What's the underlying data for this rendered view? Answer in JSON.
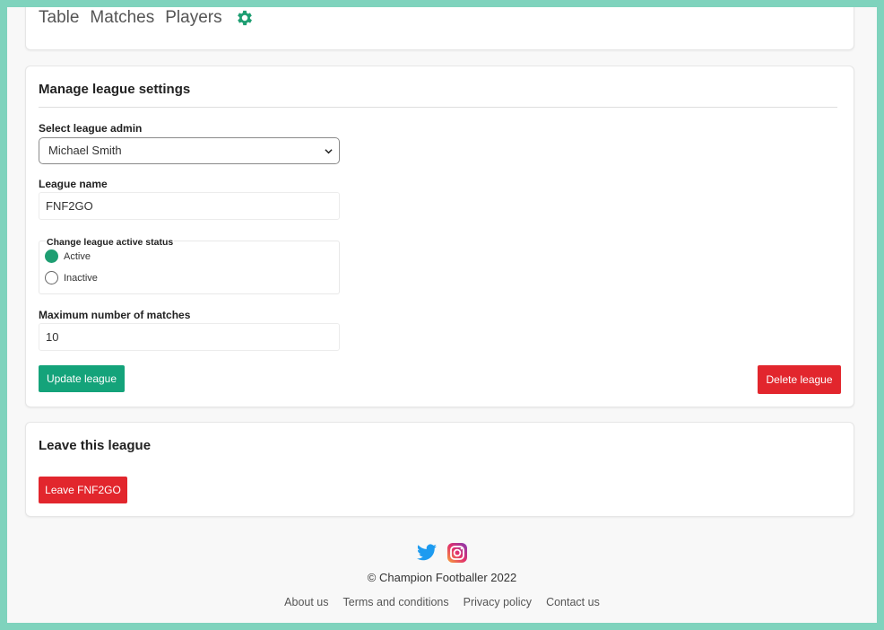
{
  "nav": {
    "tabs": [
      {
        "label": "Table"
      },
      {
        "label": "Matches"
      },
      {
        "label": "Players"
      }
    ],
    "settings_icon": "gear-icon",
    "accent": "#1e9e72"
  },
  "settings": {
    "title": "Manage league settings",
    "admin_label": "Select league admin",
    "admin_selected": "Michael Smith",
    "name_label": "League name",
    "name_value": "FNF2GO",
    "status_legend": "Change league active status",
    "status_options": [
      {
        "label": "Active",
        "checked": true
      },
      {
        "label": "Inactive",
        "checked": false
      }
    ],
    "max_matches_label": "Maximum number of matches",
    "max_matches_value": "10",
    "update_button": "Update league",
    "delete_button": "Delete league"
  },
  "leave": {
    "title": "Leave this league",
    "button": "Leave FNF2GO"
  },
  "footer": {
    "social": [
      {
        "icon": "twitter-icon"
      },
      {
        "icon": "instagram-icon"
      }
    ],
    "copyright": "© Champion Footballer 2022",
    "links": [
      {
        "label": "About us"
      },
      {
        "label": "Terms and conditions"
      },
      {
        "label": "Privacy policy"
      },
      {
        "label": "Contact us"
      }
    ]
  },
  "colors": {
    "frame_border": "#7fd3bd",
    "primary_green": "#14a37a",
    "danger_red": "#e2262d"
  }
}
